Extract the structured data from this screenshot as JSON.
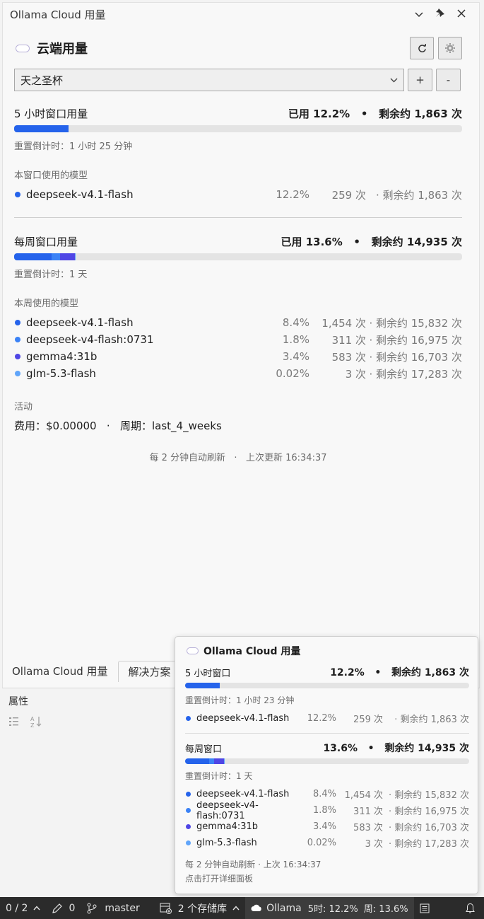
{
  "window": {
    "title": "Ollama Cloud 用量"
  },
  "header": {
    "title": "云端用量",
    "refresh_icon": "refresh-icon",
    "settings_icon": "gear-icon"
  },
  "account": {
    "selected": "天之圣杯",
    "add_label": "+",
    "remove_label": "-"
  },
  "five_hour": {
    "title": "5 小时窗口用量",
    "used": "已用 12.2%",
    "remaining": "剩余约 1,863 次",
    "used_fraction": 0.122,
    "reset": "重置倒计时：1 小时 25 分钟",
    "models_title": "本窗口使用的模型",
    "models": [
      {
        "name": "deepseek-v4.1-flash",
        "pct": "12.2%",
        "count": "259 次",
        "remaining": "· 剩余约 1,863 次",
        "color": "#2563eb"
      }
    ]
  },
  "weekly": {
    "title": "每周窗口用量",
    "used": "已用 13.6%",
    "remaining": "剩余约 14,935 次",
    "used_fraction": 0.136,
    "reset": "重置倒计时：1 天",
    "models_title": "本周使用的模型",
    "models": [
      {
        "name": "deepseek-v4.1-flash",
        "pct": "8.4%",
        "count": "1,454 次",
        "remaining": "· 剩余约 15,832 次",
        "color": "#2563eb"
      },
      {
        "name": "deepseek-v4-flash:0731",
        "pct": "1.8%",
        "count": "311 次",
        "remaining": "· 剩余约 16,975 次",
        "color": "#3b82f6"
      },
      {
        "name": "gemma4:31b",
        "pct": "3.4%",
        "count": "583 次",
        "remaining": "· 剩余约 16,703 次",
        "color": "#4f46e5"
      },
      {
        "name": "glm-5.3-flash",
        "pct": "0.02%",
        "count": "3 次",
        "remaining": "· 剩余约 17,283 次",
        "color": "#60a5fa"
      }
    ]
  },
  "activity": {
    "title": "活动",
    "cost_label": "费用：",
    "cost_value": "$0.00000",
    "period_label": "周期：",
    "period_value": "last_4_weeks"
  },
  "footer": {
    "auto_refresh": "每 2 分钟自动刷新",
    "last_update": "上次更新 16:34:37"
  },
  "tabs": [
    "Ollama Cloud 用量",
    "解决方案"
  ],
  "properties": {
    "title": "属性"
  },
  "popup": {
    "title": "Ollama Cloud 用量",
    "five_hour": {
      "title": "5 小时窗口",
      "used": "12.2%",
      "remaining": "剩余约 1,863 次",
      "reset": "重置倒计时：1 小时 23 分钟",
      "models": [
        {
          "name": "deepseek-v4.1-flash",
          "pct": "12.2%",
          "count": "259 次",
          "remaining": "· 剩余约 1,863 次",
          "color": "#2563eb"
        }
      ]
    },
    "weekly": {
      "title": "每周窗口",
      "used": "13.6%",
      "remaining": "剩余约 14,935 次",
      "reset": "重置倒计时：1 天",
      "models": [
        {
          "name": "deepseek-v4.1-flash",
          "pct": "8.4%",
          "count": "1,454 次",
          "remaining": "· 剩余约 15,832 次",
          "color": "#2563eb"
        },
        {
          "name": "deepseek-v4-flash:0731",
          "pct": "1.8%",
          "count": "311 次",
          "remaining": "· 剩余约 16,975 次",
          "color": "#3b82f6"
        },
        {
          "name": "gemma4:31b",
          "pct": "3.4%",
          "count": "583 次",
          "remaining": "· 剩余约 16,703 次",
          "color": "#4f46e5"
        },
        {
          "name": "glm-5.3-flash",
          "pct": "0.02%",
          "count": "3 次",
          "remaining": "· 剩余约 17,283 次",
          "color": "#60a5fa"
        }
      ]
    },
    "footer1": "每 2 分钟自动刷新 · 上次 16:34:37",
    "footer2": "点击打开详细面板"
  },
  "status_bar": {
    "errors": "0 / 2",
    "pencil_count": "0",
    "branch": "master",
    "repos": "2 个存储库",
    "ollama": "Ollama",
    "ollama_5h": "5时: 12.2%",
    "ollama_week": "周: 13.6%"
  }
}
